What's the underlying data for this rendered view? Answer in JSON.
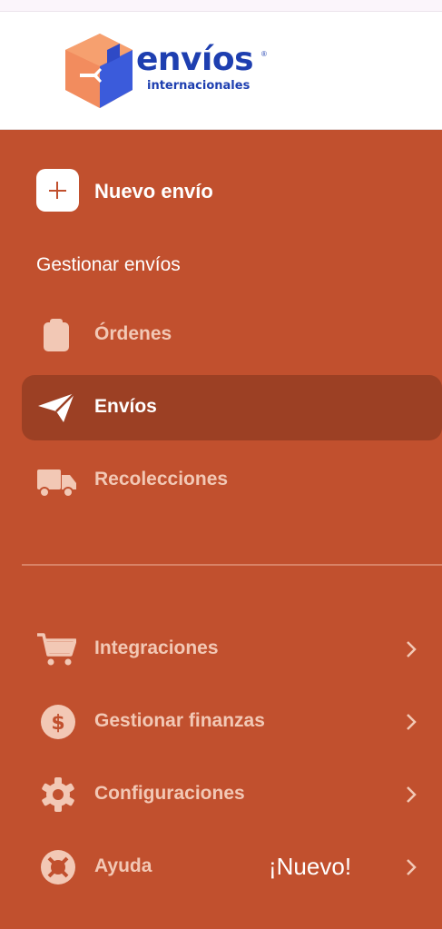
{
  "logo": {
    "wordmark": "envíos",
    "tagline": "internacionales",
    "registered": "®"
  },
  "new_shipment": {
    "label": "Nuevo envío"
  },
  "section": {
    "title": "Gestionar envíos"
  },
  "nav_items": [
    {
      "label": "Órdenes",
      "icon": "clipboard-icon"
    },
    {
      "label": "Envíos",
      "icon": "paper-plane-icon"
    },
    {
      "label": "Recolecciones",
      "icon": "truck-icon"
    }
  ],
  "secondary_items": [
    {
      "label": "Integraciones",
      "icon": "shopping-cart-icon"
    },
    {
      "label": "Gestionar finanzas",
      "icon": "dollar-icon"
    },
    {
      "label": "Configuraciones",
      "icon": "gear-icon"
    },
    {
      "label": "Ayuda",
      "icon": "lifebuoy-icon",
      "badge": "¡Nuevo!"
    }
  ],
  "colors": {
    "sidebar": "#C1502E",
    "active": "#9C4024",
    "muted_text": "#F2C8B5",
    "brand_blue": "#1E3FB0"
  }
}
